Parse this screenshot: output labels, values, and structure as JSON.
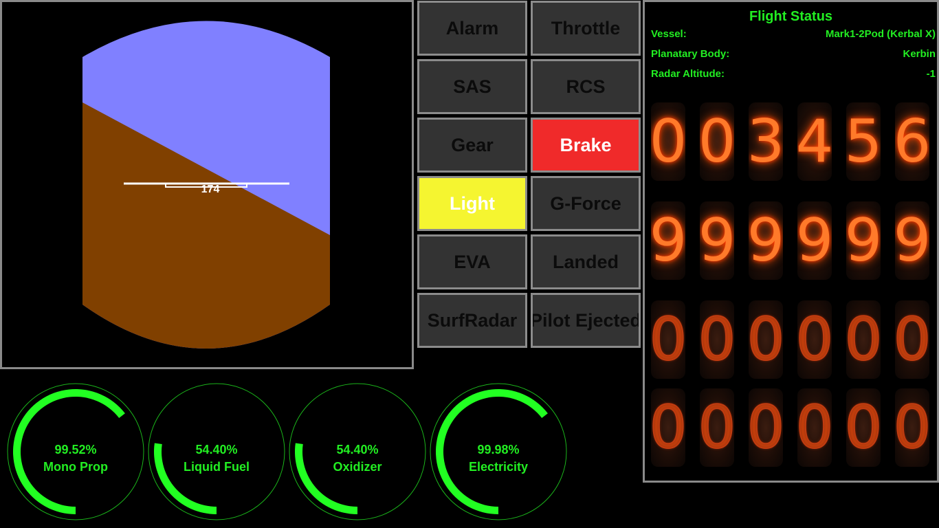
{
  "attitude": {
    "pitch_readout": "174",
    "sky_color": "#8080ff",
    "ground_color": "#804000",
    "horizon_line_color": "#ffffff"
  },
  "buttons": [
    {
      "label": "Alarm",
      "state": "off",
      "color": "#333333"
    },
    {
      "label": "Throttle",
      "state": "off",
      "color": "#333333"
    },
    {
      "label": "SAS",
      "state": "off",
      "color": "#333333"
    },
    {
      "label": "RCS",
      "state": "off",
      "color": "#333333"
    },
    {
      "label": "Gear",
      "state": "off",
      "color": "#333333"
    },
    {
      "label": "Brake",
      "state": "on",
      "color": "#f02a2a"
    },
    {
      "label": "Light",
      "state": "on",
      "color": "#f5f530"
    },
    {
      "label": "G-Force",
      "state": "off",
      "color": "#333333"
    },
    {
      "label": "EVA",
      "state": "off",
      "color": "#333333"
    },
    {
      "label": "Landed",
      "state": "off",
      "color": "#333333"
    },
    {
      "label": "SurfRadar",
      "state": "off",
      "color": "#333333"
    },
    {
      "label": "Pilot Ejected",
      "state": "off",
      "color": "#333333"
    }
  ],
  "status": {
    "title": "Flight Status",
    "vessel_label": "Vessel:",
    "vessel_value": "Mark1-2Pod (Kerbal X)",
    "body_label": "Planatary Body:",
    "body_value": "Kerbin",
    "radar_label": "Radar Altitude:",
    "radar_value": "-1",
    "text_color": "#22ee22"
  },
  "nixie_rows": [
    [
      "0",
      "0",
      "3",
      "4",
      "5",
      "6"
    ],
    [
      "9",
      "9",
      "9",
      "9",
      "9",
      "9"
    ],
    [
      "0",
      "0",
      "0",
      "0",
      "0",
      "0"
    ],
    [
      "0",
      "0",
      "0",
      "0",
      "0",
      "0"
    ]
  ],
  "gauges": [
    {
      "percent_text": "99.52%",
      "label": "Mono Prop",
      "fraction": 0.9952
    },
    {
      "percent_text": "54.40%",
      "label": "Liquid Fuel",
      "fraction": 0.544
    },
    {
      "percent_text": "54.40%",
      "label": "Oxidizer",
      "fraction": 0.544
    },
    {
      "percent_text": "99.98%",
      "label": "Electricity",
      "fraction": 0.9998
    }
  ],
  "gauge_color": "#22ff22"
}
